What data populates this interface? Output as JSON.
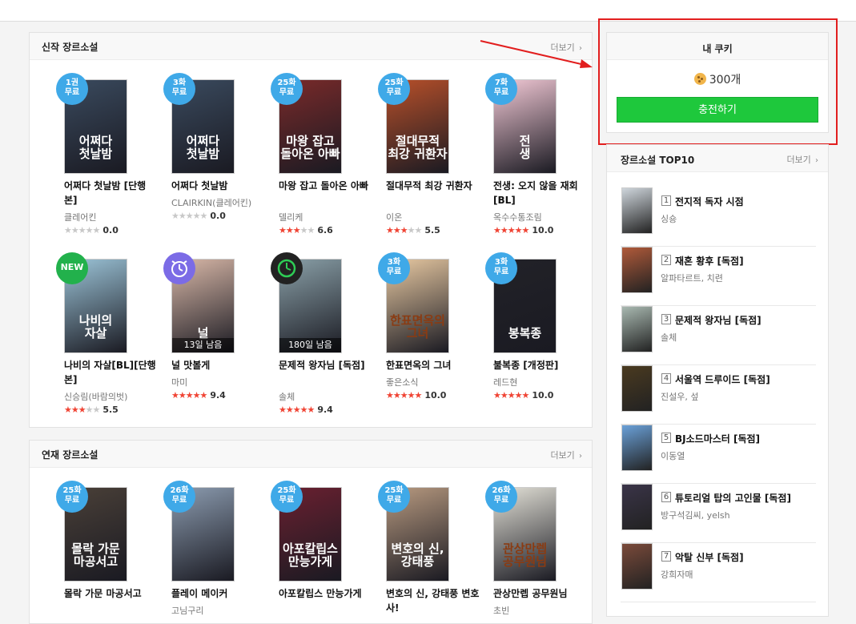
{
  "sections": {
    "new": {
      "title": "신작 장르소설",
      "more": "더보기"
    },
    "serial": {
      "title": "연재 장르소설",
      "more": "더보기"
    }
  },
  "new_books": [
    {
      "badge": "1권\n무료",
      "badge_type": "free",
      "cover_text": "어쩌다\n첫날밤",
      "cover_bg": "#3a4a5e",
      "name": "어쩌다 첫날밤 [단행본]",
      "author": "클레어킨",
      "stars": 0,
      "score": "0.0"
    },
    {
      "badge": "3화\n무료",
      "badge_type": "free",
      "cover_text": "어쩌다\n첫날밤",
      "cover_bg": "#3a4a5e",
      "name": "어쩌다 첫날밤",
      "author": "CLAIRKIN(클레어킨)",
      "stars": 0,
      "score": "0.0"
    },
    {
      "badge": "25화\n무료",
      "badge_type": "free",
      "cover_text": "마왕 잡고\n돌아온 아빠",
      "cover_bg": "#7a2a2a",
      "name": "마왕 잡고 돌아온 아빠",
      "author": "델리케",
      "stars": 3,
      "score": "6.6"
    },
    {
      "badge": "25화\n무료",
      "badge_type": "free",
      "cover_text": "절대무적\n최강 귀환자",
      "cover_bg": "#b8502a",
      "name": "절대무적 최강 귀환자",
      "author": "이온",
      "stars": 3,
      "score": "5.5"
    },
    {
      "badge": "7화\n무료",
      "badge_type": "free",
      "cover_text": "전\n생",
      "cover_bg": "#f3c9d6",
      "name": "전생: 오지 않을 재회 [BL]",
      "author": "옥수수통조림",
      "stars": 5,
      "score": "10.0"
    },
    {
      "badge": "NEW",
      "badge_type": "new",
      "cover_text": "나비의\n자살",
      "cover_bg": "#9cc4d8",
      "name": "나비의 자살[BL][단행본]",
      "author": "신승림(바람의벗)",
      "stars": 3,
      "score": "5.5"
    },
    {
      "badge": "",
      "badge_type": "clock",
      "cover_text": "널",
      "cover_bg": "#d9b8a8",
      "days": "13일 남음",
      "name": "널 맛볼게",
      "author": "마미",
      "stars": 5,
      "score": "9.4"
    },
    {
      "badge": "",
      "badge_type": "timer",
      "cover_text": "",
      "cover_bg": "#8aa0a8",
      "days": "180일 남음",
      "name": "문제적 왕자님 [독점]",
      "author": "솔체",
      "stars": 5,
      "score": "9.4"
    },
    {
      "badge": "3화\n무료",
      "badge_type": "free",
      "cover_text": "한표면옥의\n그녀",
      "cover_bg": "#e8c9a2",
      "name": "한표면옥의 그녀",
      "author": "좋은소식",
      "stars": 5,
      "score": "10.0"
    },
    {
      "badge": "3화\n무료",
      "badge_type": "free",
      "cover_text": "봉복종",
      "cover_bg": "#222228",
      "name": "불복종 [개정판]",
      "author": "레드현",
      "stars": 5,
      "score": "10.0"
    }
  ],
  "serial_books": [
    {
      "badge": "25화\n무료",
      "badge_type": "free",
      "cover_text": "몰락 가문\n마공서고",
      "cover_bg": "#4a4038",
      "name": "몰락 가문 마공서고",
      "author": ""
    },
    {
      "badge": "26화\n무료",
      "badge_type": "free",
      "cover_text": "",
      "cover_bg": "#8c9cb0",
      "name": "플레이 메이커",
      "author": "고님구리"
    },
    {
      "badge": "25화\n무료",
      "badge_type": "free",
      "cover_text": "아포칼립스\n만능가게",
      "cover_bg": "#6a2030",
      "name": "아포칼립스 만능가게",
      "author": ""
    },
    {
      "badge": "25화\n무료",
      "badge_type": "free",
      "cover_text": "변호의 신,\n강태풍",
      "cover_bg": "#b89a80",
      "name": "변호의 신, 강태풍 변호사!",
      "author": ""
    },
    {
      "badge": "26화\n무료",
      "badge_type": "free",
      "cover_text": "관상만렙\n공무원님",
      "cover_bg": "#e4e2d8",
      "name": "관상만렙 공무원님",
      "author": "초빈"
    }
  ],
  "cookie": {
    "title": "내 쿠키",
    "count": "300개",
    "charge": "충전하기"
  },
  "top10": {
    "title": "장르소설 TOP10",
    "more": "더보기",
    "items": [
      {
        "rank": "1",
        "title": "전지적 독자 시점",
        "author": "싱숑",
        "bg": "#cfd6dc"
      },
      {
        "rank": "2",
        "title": "재혼 황후 [독점]",
        "author": "알파타르트, 치련",
        "bg": "#b05a3a"
      },
      {
        "rank": "3",
        "title": "문제적 왕자님 [독점]",
        "author": "솔체",
        "bg": "#a8b8b0"
      },
      {
        "rank": "4",
        "title": "서울역 드루이드 [독점]",
        "author": "진설우, 섶",
        "bg": "#4a3a20"
      },
      {
        "rank": "5",
        "title": "BJ소드마스터 [독점]",
        "author": "이동열",
        "bg": "#6aa0d8"
      },
      {
        "rank": "6",
        "title": "튜토리얼 탑의 고인물 [독점]",
        "author": "방구석김씨, yelsh",
        "bg": "#3a3448"
      },
      {
        "rank": "7",
        "title": "악탈 신부 [독점]",
        "author": "강희자매",
        "bg": "#7a4a3a"
      }
    ]
  },
  "colors": {
    "badge_blue": "#3fa9e8",
    "new_green": "#22b14c",
    "charge_green": "#1ec83c",
    "star_red": "#f04434",
    "annotation_red": "#e21e1e"
  }
}
